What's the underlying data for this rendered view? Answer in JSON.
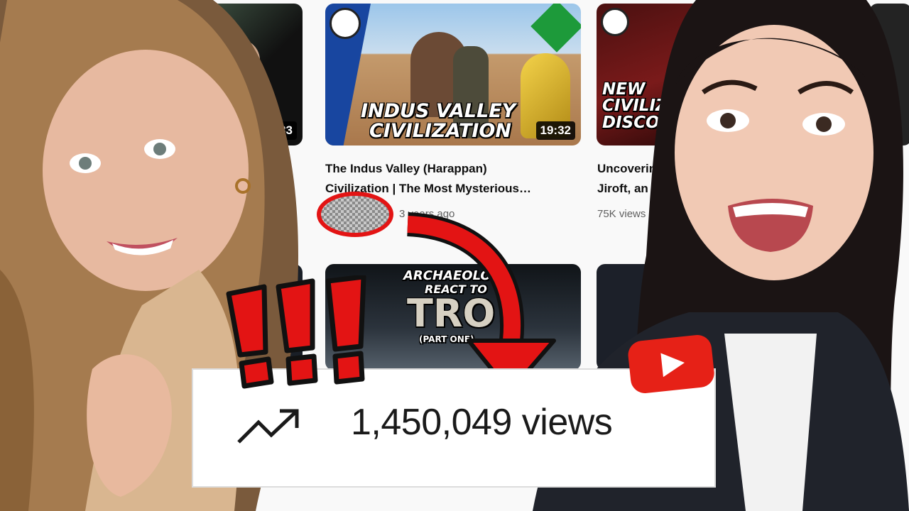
{
  "videos": [
    {
      "duration": "8:33"
    },
    {
      "title_line1": "The Indus Valley (Harappan)",
      "title_line2": "Civilization | The Most Mysterious…",
      "meta": "3 years ago",
      "thumb_text_line1": "INDUS VALLEY",
      "thumb_text_line2": "CIVILIZATION",
      "duration": "19:32"
    },
    {
      "title_line1": "Uncovering",
      "title_line2": "Jiroft, an A",
      "meta": "75K views •",
      "thumb_text_line1": "NEW",
      "thumb_text_line2": "CIVILIZA",
      "thumb_text_line3": "DISCOV"
    },
    {
      "thumb_text_line1": "ARCHAEOLO",
      "thumb_text_line2": "REACT TO",
      "thumb_text_line3": "TRO",
      "thumb_text_line4": "(PART ONE)"
    }
  ],
  "highlight": {
    "views": "1,450,049 views",
    "exclamation": "!!!"
  },
  "icons": {
    "trend": "trending-up-icon",
    "logo": "youtube-logo-icon",
    "arrow": "curved-arrow-icon"
  },
  "colors": {
    "accent_red": "#e31414",
    "youtube_red": "#e62117"
  }
}
